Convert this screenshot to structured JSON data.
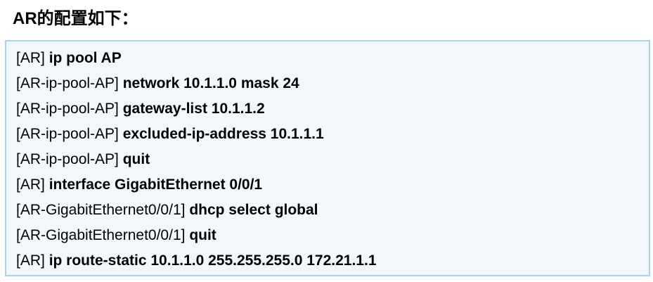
{
  "heading": "AR的配置如下：",
  "config_lines": [
    {
      "prompt": "[AR]",
      "command": "ip pool AP"
    },
    {
      "prompt": "[AR-ip-pool-AP]",
      "command": "network 10.1.1.0 mask 24"
    },
    {
      "prompt": "[AR-ip-pool-AP]",
      "command": "gateway-list 10.1.1.2"
    },
    {
      "prompt": "[AR-ip-pool-AP]",
      "command": "excluded-ip-address 10.1.1.1"
    },
    {
      "prompt": "[AR-ip-pool-AP]",
      "command": "quit"
    },
    {
      "prompt": "[AR]",
      "command": "interface GigabitEthernet 0/0/1"
    },
    {
      "prompt": "[AR-GigabitEthernet0/0/1]",
      "command": "dhcp select global"
    },
    {
      "prompt": "[AR-GigabitEthernet0/0/1]",
      "command": "quit"
    },
    {
      "prompt": "[AR]",
      "command": "ip route-static 10.1.1.0 255.255.255.0 172.21.1.1"
    }
  ]
}
